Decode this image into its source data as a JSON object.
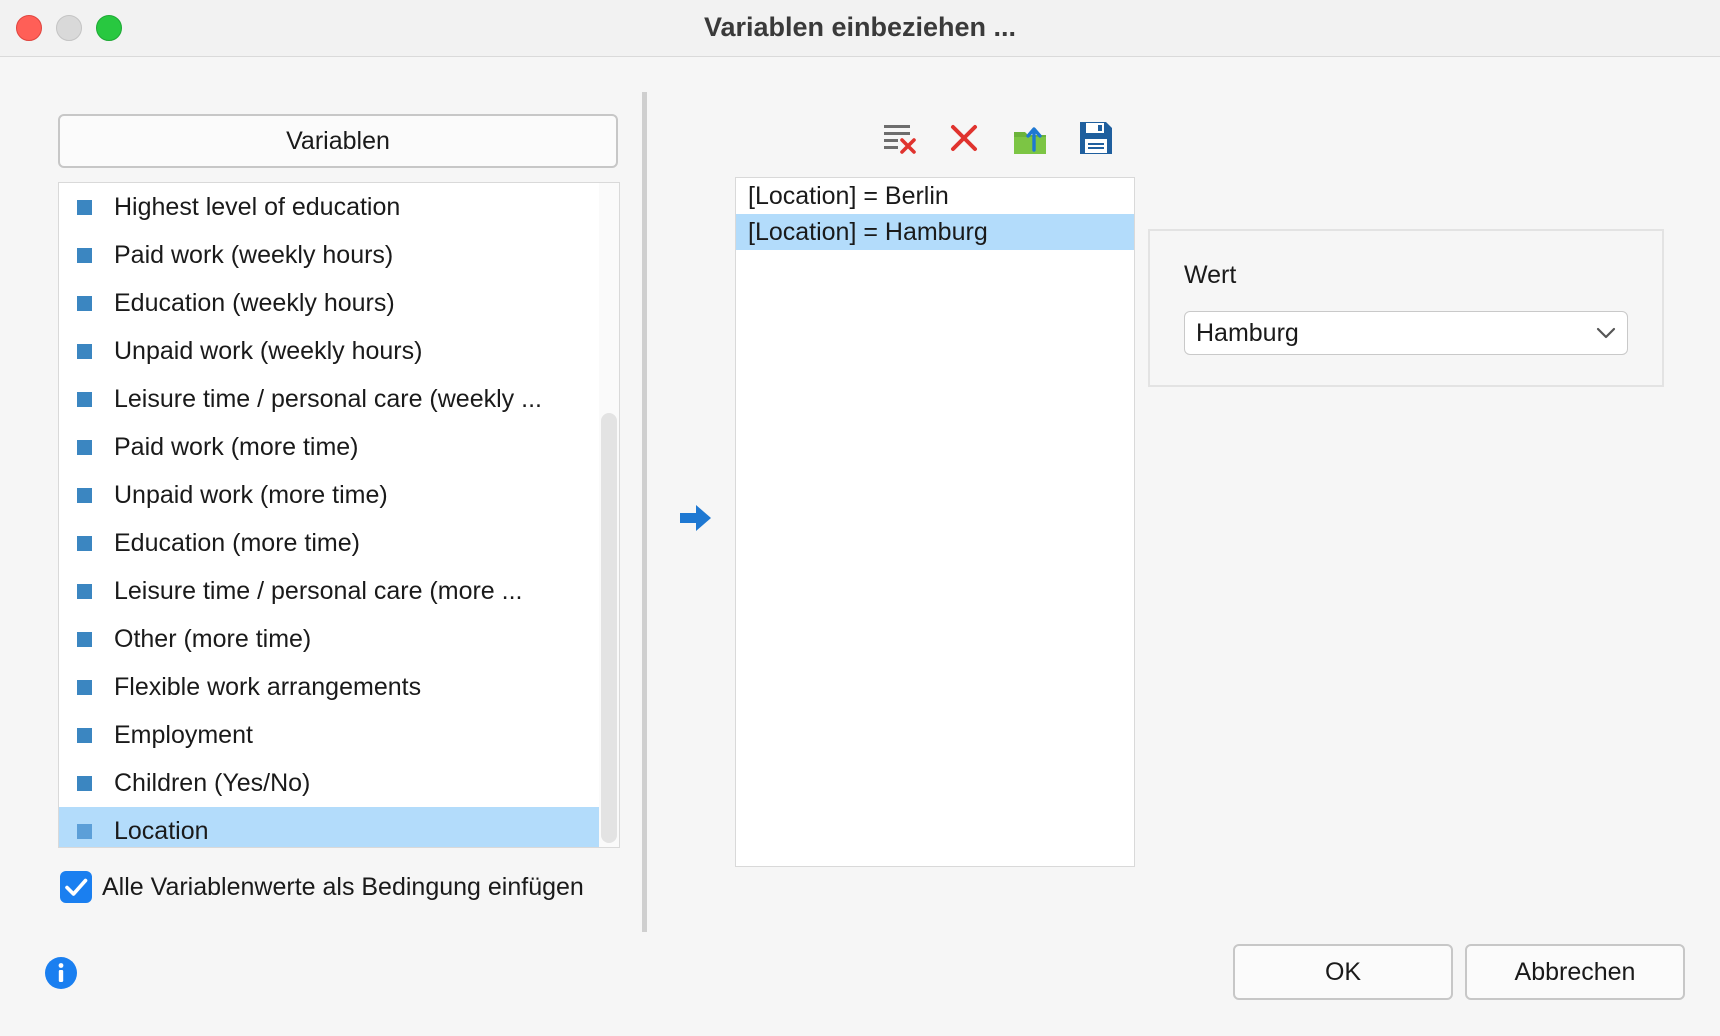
{
  "window": {
    "title": "Variablen einbeziehen ..."
  },
  "variables": {
    "header_label": "Variablen",
    "items": [
      {
        "label": "Highest level of education"
      },
      {
        "label": "Paid work (weekly hours)"
      },
      {
        "label": "Education (weekly hours)"
      },
      {
        "label": "Unpaid work (weekly hours)"
      },
      {
        "label": "Leisure time / personal care (weekly ..."
      },
      {
        "label": "Paid work (more time)"
      },
      {
        "label": "Unpaid work (more time)"
      },
      {
        "label": "Education (more time)"
      },
      {
        "label": "Leisure time / personal care (more ..."
      },
      {
        "label": "Other (more time)"
      },
      {
        "label": "Flexible work arrangements"
      },
      {
        "label": "Employment"
      },
      {
        "label": "Children  (Yes/No)"
      },
      {
        "label": "Location",
        "selected": true
      }
    ],
    "item_icon": "variable-square-icon"
  },
  "checkbox": {
    "label": "Alle Variablenwerte als Bedingung einfügen",
    "checked": true
  },
  "toolbar": {
    "icons": [
      "clear-list-icon",
      "delete-x-icon",
      "export-icon",
      "save-disk-icon"
    ]
  },
  "conditions": {
    "items": [
      {
        "label": "[Location] = Berlin"
      },
      {
        "label": "[Location] = Hamburg",
        "selected": true
      }
    ]
  },
  "value_panel": {
    "label": "Wert",
    "selected_value": "Hamburg"
  },
  "buttons": {
    "ok": "OK",
    "cancel": "Abbrechen"
  },
  "colors": {
    "selection": "#b3dcfb",
    "accent": "#1a7ff0",
    "delete": "#e0332e",
    "icon_blue": "#2a6ab0"
  }
}
